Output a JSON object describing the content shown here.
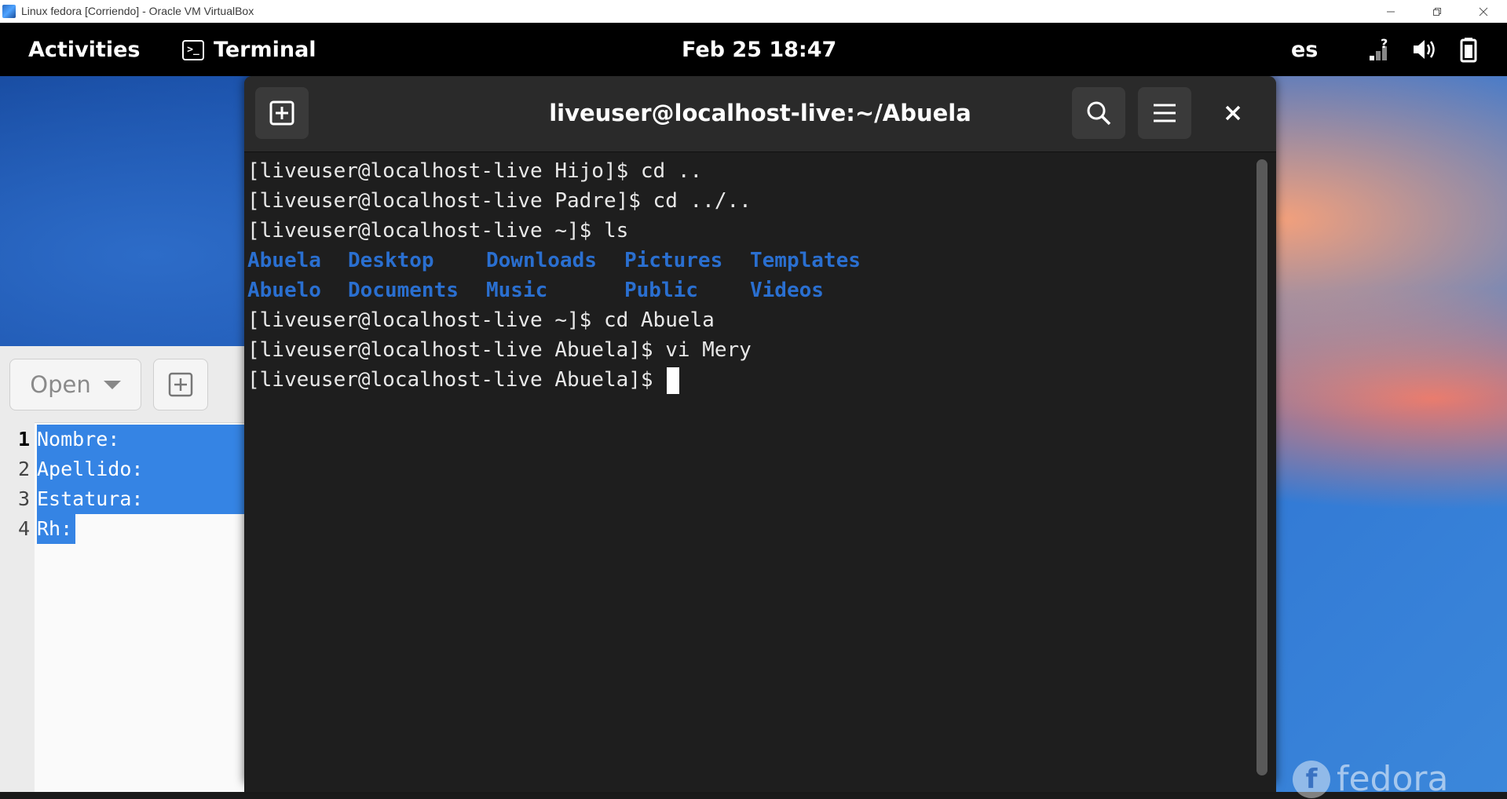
{
  "vbox": {
    "title": "Linux fedora [Corriendo] - Oracle VM VirtualBox"
  },
  "gnome": {
    "activities": "Activities",
    "app_name": "Terminal",
    "clock": "Feb 25  18:47",
    "lang": "es"
  },
  "wallpaper": {
    "brand": "fedora"
  },
  "editor": {
    "open_label": "Open",
    "lines": [
      {
        "num": "1",
        "text": "Nombre:"
      },
      {
        "num": "2",
        "text": "Apellido:"
      },
      {
        "num": "3",
        "text": "Estatura:"
      },
      {
        "num": "4",
        "text": "Rh:"
      }
    ]
  },
  "terminal": {
    "title": "liveuser@localhost-live:~/Abuela",
    "lines": [
      "[liveuser@localhost-live Hijo]$ cd ..",
      "[liveuser@localhost-live Padre]$ cd ../..",
      "[liveuser@localhost-live ~]$ ls"
    ],
    "ls_row1": [
      "Abuela",
      "Desktop",
      "Downloads",
      "Pictures",
      "Templates"
    ],
    "ls_row2": [
      "Abuelo",
      "Documents",
      "Music",
      "Public",
      "Videos"
    ],
    "lines_after": [
      "[liveuser@localhost-live ~]$ cd Abuela",
      "[liveuser@localhost-live Abuela]$ vi Mery"
    ],
    "prompt": "[liveuser@localhost-live Abuela]$ "
  },
  "colors": {
    "accent": "#3584e4",
    "dir_blue": "#2a6fd0",
    "terminal_bg": "#1e1e1e"
  },
  "icons": [
    "virtualbox-icon",
    "terminal-icon",
    "network-icon",
    "volume-icon",
    "battery-icon",
    "new-tab-icon",
    "search-icon",
    "menu-icon",
    "close-icon",
    "new-document-icon",
    "dropdown-caret-icon",
    "fedora-logo-icon"
  ]
}
